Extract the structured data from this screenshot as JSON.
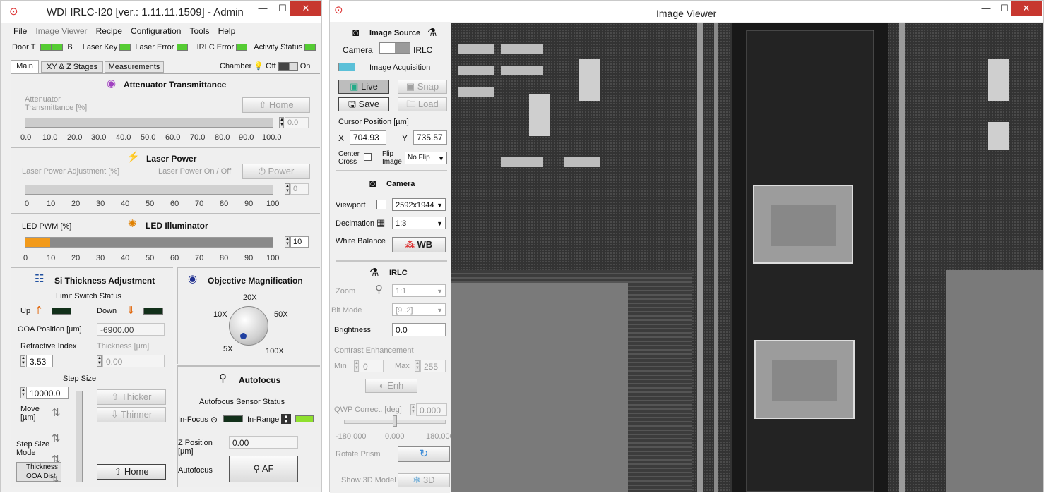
{
  "left": {
    "title": "WDI IRLC-I20 [ver.: 1.11.11.1509] - Admin",
    "menu": [
      "File",
      "Image Viewer",
      "Recipe",
      "Configuration",
      "Tools",
      "Help"
    ],
    "status": {
      "door_t": "Door T",
      "door_b": "B",
      "laser_key": "Laser Key",
      "laser_error": "Laser Error",
      "irlc_error": "IRLC Error",
      "activity": "Activity Status"
    },
    "tabs": [
      "Main",
      "XY & Z Stages",
      "Measurements"
    ],
    "chamber": {
      "label": "Chamber",
      "off": "Off",
      "on": "On"
    },
    "attenuator": {
      "title": "Attenuator Transmittance",
      "label": "Attenuator\nTransmittance [%]",
      "home": "Home",
      "value": "0.0",
      "ticks": [
        "0.0",
        "10.0",
        "20.0",
        "30.0",
        "40.0",
        "50.0",
        "60.0",
        "70.0",
        "80.0",
        "90.0",
        "100.0"
      ]
    },
    "laser": {
      "title": "Laser Power",
      "adj_label": "Laser Power Adjustment [%]",
      "onoff_label": "Laser Power On / Off",
      "power": "Power",
      "value": "0",
      "ticks": [
        "0",
        "10",
        "20",
        "30",
        "40",
        "50",
        "60",
        "70",
        "80",
        "90",
        "100"
      ]
    },
    "led": {
      "title": "LED Illuminator",
      "pwm_label": "LED PWM [%]",
      "value": "10",
      "level": 10,
      "ticks": [
        "0",
        "10",
        "20",
        "30",
        "40",
        "50",
        "60",
        "70",
        "80",
        "90",
        "100"
      ]
    },
    "si": {
      "title": "Si Thickness Adjustment",
      "limit": "Limit Switch Status",
      "up": "Up",
      "down": "Down",
      "ooa_label": "OOA Position [µm]",
      "ooa_value": "-6900.00",
      "ri_label": "Refractive Index",
      "ri_value": "3.53",
      "thick_label": "Thickness [µm]",
      "thick_value": "0.00",
      "step_label": "Step Size",
      "step_value": "10000.0",
      "move": "Move\n[µm]",
      "thicker": "Thicker",
      "thinner": "Thinner",
      "ssm": "Step Size\nMode",
      "mode_opt1": "Thickness",
      "mode_opt2": "OOA Dist.",
      "home": "Home"
    },
    "objective": {
      "title": "Objective Magnification",
      "m20": "20X",
      "m10": "10X",
      "m50": "50X",
      "m5": "5X",
      "m100": "100X"
    },
    "autofocus": {
      "title": "Autofocus",
      "sensor": "Autofocus Sensor Status",
      "in_focus": "In-Focus",
      "in_range": "In-Range",
      "zpos_label": "Z Position\n[µm]",
      "zpos_value": "0.00",
      "af_label": "Autofocus",
      "af": "AF"
    }
  },
  "right": {
    "title": "Image Viewer",
    "source": {
      "title": "Image Source",
      "camera": "Camera",
      "irlc": "IRLC"
    },
    "acq": {
      "title": "Image Acquisition",
      "live": "Live",
      "snap": "Snap",
      "save": "Save",
      "load": "Load"
    },
    "cursor": {
      "title": "Cursor Position [µm]",
      "x_label": "X",
      "x": "704.93",
      "y_label": "Y",
      "y": "735.57"
    },
    "center_cross": "Center\nCross",
    "flip_label": "Flip\nImage",
    "flip": "No Flip",
    "camera": {
      "title": "Camera",
      "viewport_label": "Viewport",
      "viewport": "2592x1944",
      "decimation_label": "Decimation",
      "decimation": "1:3",
      "wb_label": "White Balance",
      "wb": "WB"
    },
    "irlc": {
      "title": "IRLC",
      "zoom_label": "Zoom",
      "zoom": "1:1",
      "bit_label": "Bit Mode",
      "bit": "[9..2]",
      "bright_label": "Brightness",
      "bright": "0.0",
      "contrast": "Contrast Enhancement",
      "min_label": "Min",
      "min": "0",
      "max_label": "Max",
      "max": "255",
      "enh": "Enh",
      "qwp_label": "QWP Correct. [deg]",
      "qwp": "0.000",
      "qwp_min": "-180.000",
      "qwp_mid": "0.000",
      "qwp_max": "180.000",
      "rotate": "Rotate Prism",
      "model": "Show 3D Model",
      "model_btn": "3D"
    }
  }
}
